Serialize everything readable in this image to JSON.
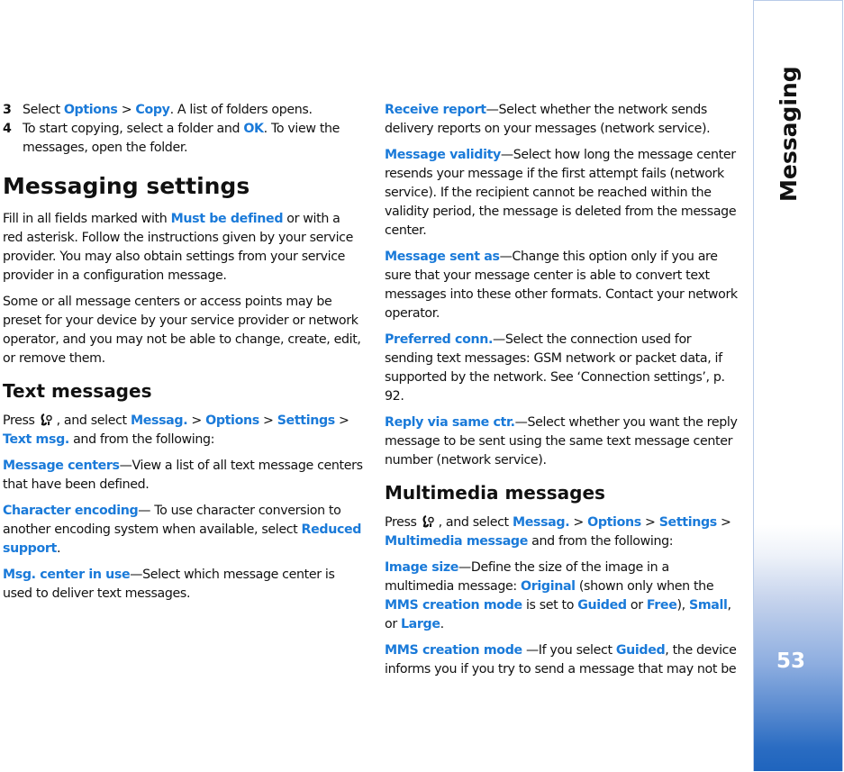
{
  "sidebar": {
    "section_title": "Messaging",
    "page_number": "53"
  },
  "colors": {
    "link": "#1a7ad9",
    "sidebar_gradient_end": "#1f64bd"
  },
  "left_column": {
    "steps": [
      {
        "num": "3",
        "parts": [
          "Select ",
          "Options",
          " > ",
          "Copy",
          ". A list of folders opens."
        ]
      },
      {
        "num": "4",
        "parts": [
          "To start copying, select a folder and ",
          "OK",
          ". To view the messages, open the folder."
        ]
      }
    ],
    "heading_main": "Messaging settings",
    "intro_para1": {
      "before": "Fill in all fields marked with ",
      "link": "Must be defined",
      "after": " or with a red asterisk. Follow the instructions given by your service provider. You may also obtain settings from your service provider in a configuration message."
    },
    "intro_para2": "Some or all message centers or access points may be preset for your device by your service provider or network operator, and you may not be able to change, create, edit, or remove them.",
    "heading_text": "Text messages",
    "press_line": {
      "press": "Press",
      "icon": "menu-key-icon",
      "select": ", and select ",
      "path": [
        "Messag.",
        "Options",
        "Settings",
        "Text msg."
      ],
      "sep": " > ",
      "tail": " and from the following:"
    },
    "items": [
      {
        "term": "Message centers",
        "desc": "—View a list of all text message centers that have been defined."
      },
      {
        "term": "Character encoding",
        "desc": "— To use character conversion to another encoding system when available, select ",
        "link2": "Reduced support",
        "tail": "."
      },
      {
        "term": "Msg. center in use",
        "desc": "—Select which message center is used to deliver text messages."
      }
    ]
  },
  "right_column": {
    "items": [
      {
        "term": "Receive report",
        "desc": "—Select whether the network sends delivery reports on your messages (network service)."
      },
      {
        "term": "Message validity",
        "desc": "—Select how long the message center resends your message if the first attempt fails (network service). If the recipient cannot be reached within the validity period, the message is deleted from the message center."
      },
      {
        "term": "Message sent as",
        "desc": "—Change this option only if you are sure that your message center is able to convert text messages into these other formats. Contact your network operator."
      },
      {
        "term": "Preferred conn.",
        "desc": "—Select the connection used for sending text messages: GSM network or packet data, if supported by the network. See ‘Connection settings’, p. 92."
      },
      {
        "term": "Reply via same ctr.",
        "desc": "—Select whether you want the reply message to be sent using the same text message center number (network service)."
      }
    ],
    "heading_mms": "Multimedia messages",
    "press_line": {
      "press": "Press",
      "select": ", and select ",
      "path": [
        "Messag.",
        "Options",
        "Settings",
        "Multimedia message"
      ],
      "sep": " > ",
      "tail": " and from the following:"
    },
    "image_size": {
      "term": "Image size",
      "t1": "—Define the size of the image in a multimedia message: ",
      "l1": "Original",
      "t2": " (shown only when the ",
      "l2": "MMS creation mode",
      "t3": " is set to ",
      "l3": "Guided",
      "t4": " or ",
      "l4": "Free",
      "t5": "), ",
      "l5": "Small",
      "t6": ", or ",
      "l6": "Large",
      "t7": "."
    },
    "mms_mode": {
      "term": "MMS creation mode",
      "t1": " —If you select ",
      "l1": "Guided",
      "t2": ", the device informs you if you try to send a message that may not be"
    }
  }
}
